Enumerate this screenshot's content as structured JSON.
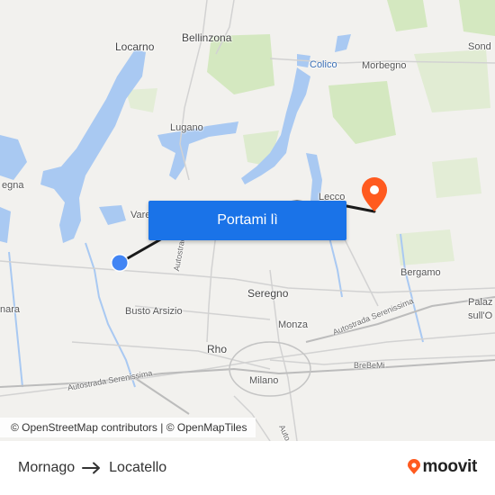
{
  "map": {
    "places": [
      {
        "id": "locarno",
        "label": "Locarno",
        "cls": "big"
      },
      {
        "id": "bellinzona",
        "label": "Bellinzona",
        "cls": "big"
      },
      {
        "id": "sondrio",
        "label": "Sond",
        "cls": ""
      },
      {
        "id": "colico",
        "label": "Colico",
        "cls": "water"
      },
      {
        "id": "morbegno",
        "label": "Morbegno",
        "cls": ""
      },
      {
        "id": "lugano",
        "label": "Lugano",
        "cls": ""
      },
      {
        "id": "verbania",
        "label": "egna",
        "cls": ""
      },
      {
        "id": "varese",
        "label": "Vare",
        "cls": ""
      },
      {
        "id": "lecco",
        "label": "Lecco",
        "cls": ""
      },
      {
        "id": "seregno",
        "label": "Seregno",
        "cls": "big"
      },
      {
        "id": "bergamo",
        "label": "Bergamo",
        "cls": ""
      },
      {
        "id": "busto",
        "label": "Busto Arsizio",
        "cls": ""
      },
      {
        "id": "monza",
        "label": "Monza",
        "cls": ""
      },
      {
        "id": "novara",
        "label": "nara",
        "cls": ""
      },
      {
        "id": "rho",
        "label": "Rho",
        "cls": "big"
      },
      {
        "id": "milano",
        "label": "Milano",
        "cls": ""
      },
      {
        "id": "palazzolo1",
        "label": "Palaz",
        "cls": ""
      },
      {
        "id": "palazzolo2",
        "label": "sull'O",
        "cls": ""
      },
      {
        "id": "brebemi",
        "label": "BreBeMi",
        "cls": "road-label"
      }
    ],
    "roads": [
      {
        "id": "autostrada-dei",
        "label": "Autostrada dei L"
      },
      {
        "id": "serenissima-east",
        "label": "Autostrada Serenissima"
      },
      {
        "id": "serenissima-west",
        "label": "Autostrada Serenissima"
      },
      {
        "id": "auto-south",
        "label": "Auto"
      }
    ]
  },
  "cta": {
    "label": "Portami lì"
  },
  "attribution": "© OpenStreetMap contributors | © OpenMapTiles",
  "route": {
    "from": "Mornago",
    "to": "Locatello"
  },
  "brand": {
    "name": "moovit"
  },
  "colors": {
    "accent": "#1a73e8",
    "route_line": "#1a1a1a",
    "destination_pin": "#ff5a1f",
    "origin_dot": "#4285f4",
    "water": "#a7c7f2",
    "park": "#c8e6b0",
    "brand": "#ff5a1f"
  },
  "icons": {
    "origin": "origin-dot-icon",
    "destination": "destination-pin-icon",
    "arrow": "arrow-right-icon",
    "brand": "moovit-logo-icon"
  }
}
